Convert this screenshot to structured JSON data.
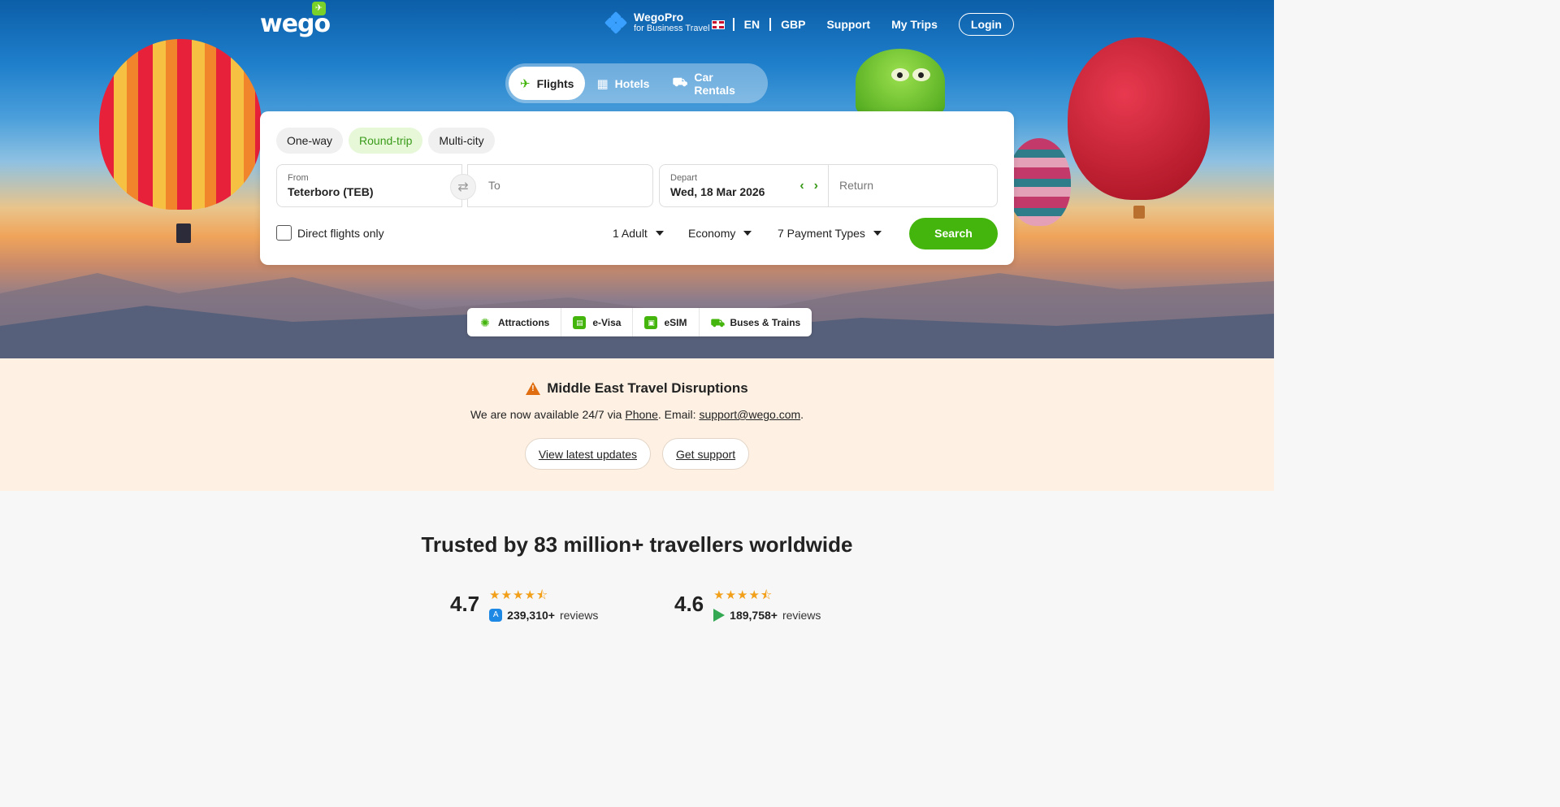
{
  "brand": {
    "logo": "wego"
  },
  "header": {
    "wegopro_title": "WegoPro",
    "wegopro_sub": "for Business Travel",
    "language": "EN",
    "currency": "GBP",
    "support": "Support",
    "my_trips": "My Trips",
    "login": "Login"
  },
  "tabs": [
    {
      "label": "Flights",
      "icon": "plane-icon",
      "active": true
    },
    {
      "label": "Hotels",
      "icon": "building-icon",
      "active": false
    },
    {
      "label": "Car Rentals",
      "icon": "car-icon",
      "active": false
    }
  ],
  "search": {
    "trip_types": [
      "One-way",
      "Round-trip",
      "Multi-city"
    ],
    "selected_trip": "Round-trip",
    "from_label": "From",
    "from_value": "Teterboro (TEB)",
    "to_placeholder": "To",
    "depart_label": "Depart",
    "depart_value": "Wed, 18 Mar 2026",
    "return_placeholder": "Return",
    "direct_only": "Direct flights only",
    "passengers": "1 Adult",
    "cabin": "Economy",
    "payment_types": "7 Payment Types",
    "search_button": "Search"
  },
  "services": [
    "Attractions",
    "e-Visa",
    "eSIM",
    "Buses & Trains"
  ],
  "alert": {
    "title": "Middle East Travel Disruptions",
    "text_prefix": "We are now available 24/7 via ",
    "phone_link": "Phone",
    "text_mid": ". Email: ",
    "email_link": "support@wego.com",
    "text_suffix": ".",
    "btn_updates": "View latest updates",
    "btn_support": "Get support"
  },
  "trust": {
    "title": "Trusted by 83 million+ travellers worldwide",
    "app_store": {
      "score": "4.7",
      "count": "239,310+",
      "label": "reviews"
    },
    "play_store": {
      "score": "4.6",
      "count": "189,758+",
      "label": "reviews"
    }
  },
  "colors": {
    "accent": "#44b50c",
    "warning": "#e06d10",
    "star": "#f29f1a"
  }
}
